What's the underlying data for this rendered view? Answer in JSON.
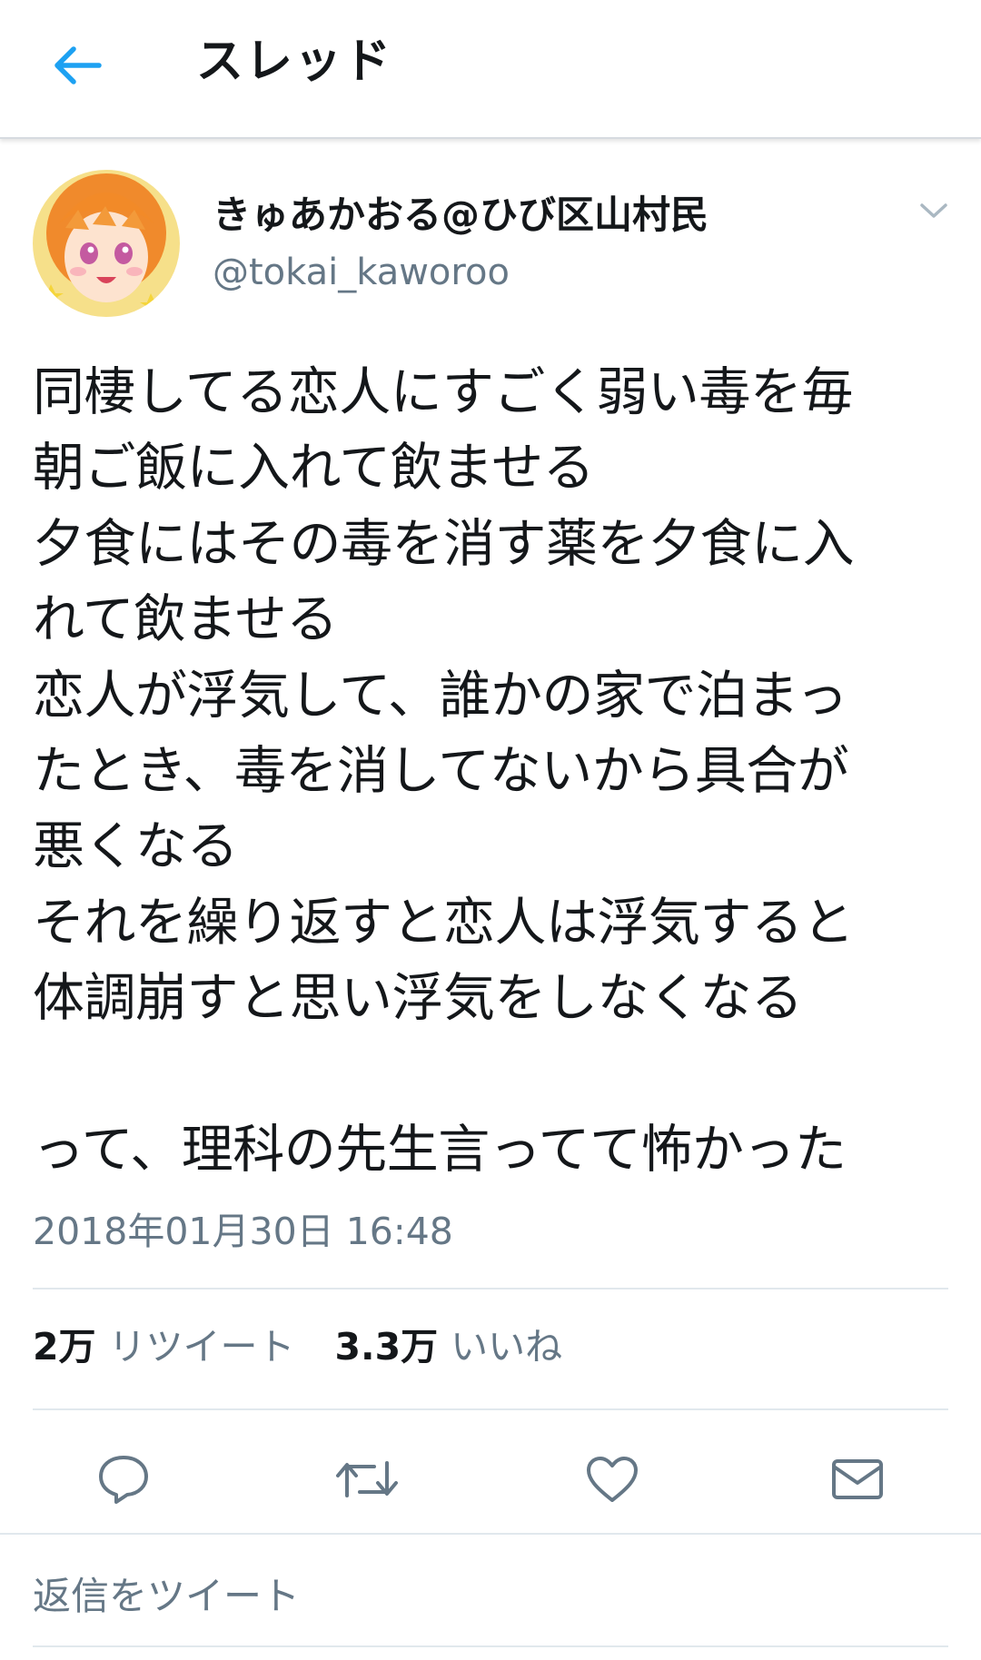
{
  "header": {
    "title": "スレッド",
    "back_icon": "arrow-left-icon",
    "accent": "#1da1f2"
  },
  "tweet": {
    "author": {
      "display_name": "きゅあかおる@ひび区山村民",
      "handle": "@tokai_kaworoo"
    },
    "text_lines": [
      "同棲してる恋人にすごく弱い毒を毎",
      "朝ご飯に入れて飲ませる",
      "夕食にはその毒を消す薬を夕食に入",
      "れて飲ませる",
      "恋人が浮気して、誰かの家で泊まっ",
      "たとき、毒を消してないから具合が",
      "悪くなる",
      "それを繰り返すと恋人は浮気すると",
      "体調崩すと思い浮気をしなくなる",
      "",
      "って、理科の先生言ってて怖かった"
    ],
    "timestamp": "2018年01月30日 16:48",
    "stats": {
      "retweets_count": "2万",
      "retweets_label": "リツイート",
      "likes_count": "3.3万",
      "likes_label": "いいね"
    },
    "actions": [
      "reply-icon",
      "retweet-icon",
      "like-icon",
      "share-message-icon"
    ]
  },
  "reply_box": {
    "placeholder": "返信をツイート"
  },
  "colors": {
    "text": "#14171a",
    "secondary": "#657786",
    "divider": "#e1e8ed"
  }
}
